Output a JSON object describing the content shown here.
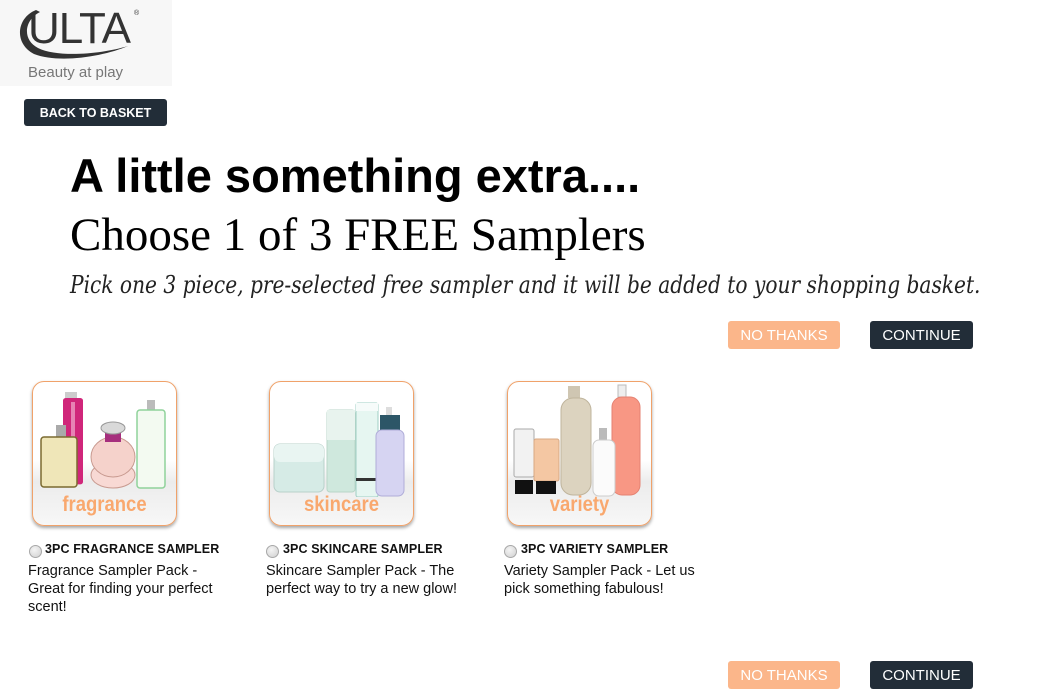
{
  "brand": {
    "logo_text": "ULTA",
    "registered_mark": "®",
    "tagline": "Beauty at play"
  },
  "nav": {
    "back_label": "BACK TO BASKET"
  },
  "header": {
    "headline": "A little something extra....",
    "subhead": "Choose 1 of 3 FREE Samplers",
    "instructions": "Pick one 3 piece, pre-selected free sampler and it will be added to your shopping basket."
  },
  "actions_top": {
    "no_thanks_label": "NO THANKS",
    "continue_label": "CONTINUE"
  },
  "actions_bottom": {
    "no_thanks_label": "NO THANKS",
    "continue_label": "CONTINUE"
  },
  "samplers": [
    {
      "image_label": "fragrance",
      "title": "3PC FRAGRANCE SAMPLER",
      "description": "Fragrance Sampler Pack - Great for finding your perfect scent!",
      "selected": false
    },
    {
      "image_label": "skincare",
      "title": "3PC SKINCARE SAMPLER",
      "description": "Skincare Sampler Pack - The perfect way to try a new glow!",
      "selected": false
    },
    {
      "image_label": "variety",
      "title": "3PC VARIETY SAMPLER",
      "description": "Variety Sampler Pack - Let us pick something fabulous!",
      "selected": false
    }
  ],
  "colors": {
    "accent_orange": "#fbb68a",
    "dark_navy": "#222d38",
    "label_orange": "#f9a86e"
  }
}
